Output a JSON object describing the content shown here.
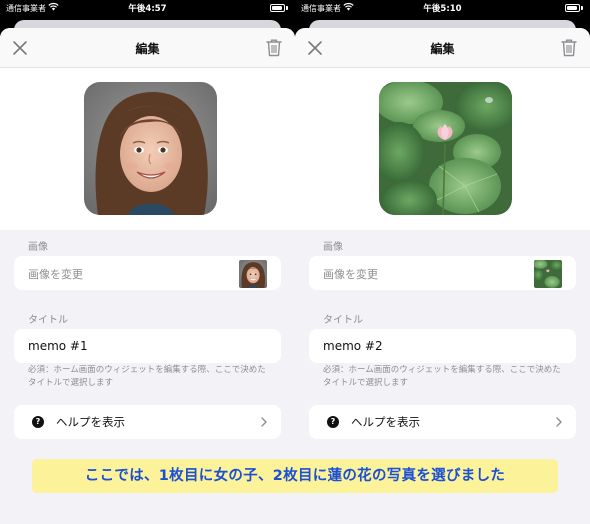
{
  "colors": {
    "accent_caption_text": "#1a4fd6",
    "caption_bg": "#fcf29a",
    "sheet_bg": "#f2f2f7",
    "secondary_text": "#8e8e93"
  },
  "screens": [
    {
      "status": {
        "carrier": "通信事業者",
        "time": "午後4:57",
        "battery_percent": 92
      },
      "nav": {
        "title": "編集"
      },
      "image_section": {
        "label": "画像",
        "change_label": "画像を変更"
      },
      "photo_description_icon": "girl-portrait",
      "title_section": {
        "label": "タイトル",
        "value": "memo #1"
      },
      "note": "必須：ホーム画面のウィジェットを編集する際、ここで決めたタイトルで選択します",
      "help": {
        "label": "ヘルプを表示",
        "icon": "?"
      }
    },
    {
      "status": {
        "carrier": "通信事業者",
        "time": "午後5:10",
        "battery_percent": 92
      },
      "nav": {
        "title": "編集"
      },
      "image_section": {
        "label": "画像",
        "change_label": "画像を変更"
      },
      "photo_description_icon": "lotus-flower",
      "title_section": {
        "label": "タイトル",
        "value": "memo #2"
      },
      "note": "必須：ホーム画面のウィジェットを編集する際、ここで決めたタイトルで選択します",
      "help": {
        "label": "ヘルプを表示",
        "icon": "?"
      }
    }
  ],
  "caption": "ここでは、1枚目に女の子、2枚目に蓮の花の写真を選びました"
}
